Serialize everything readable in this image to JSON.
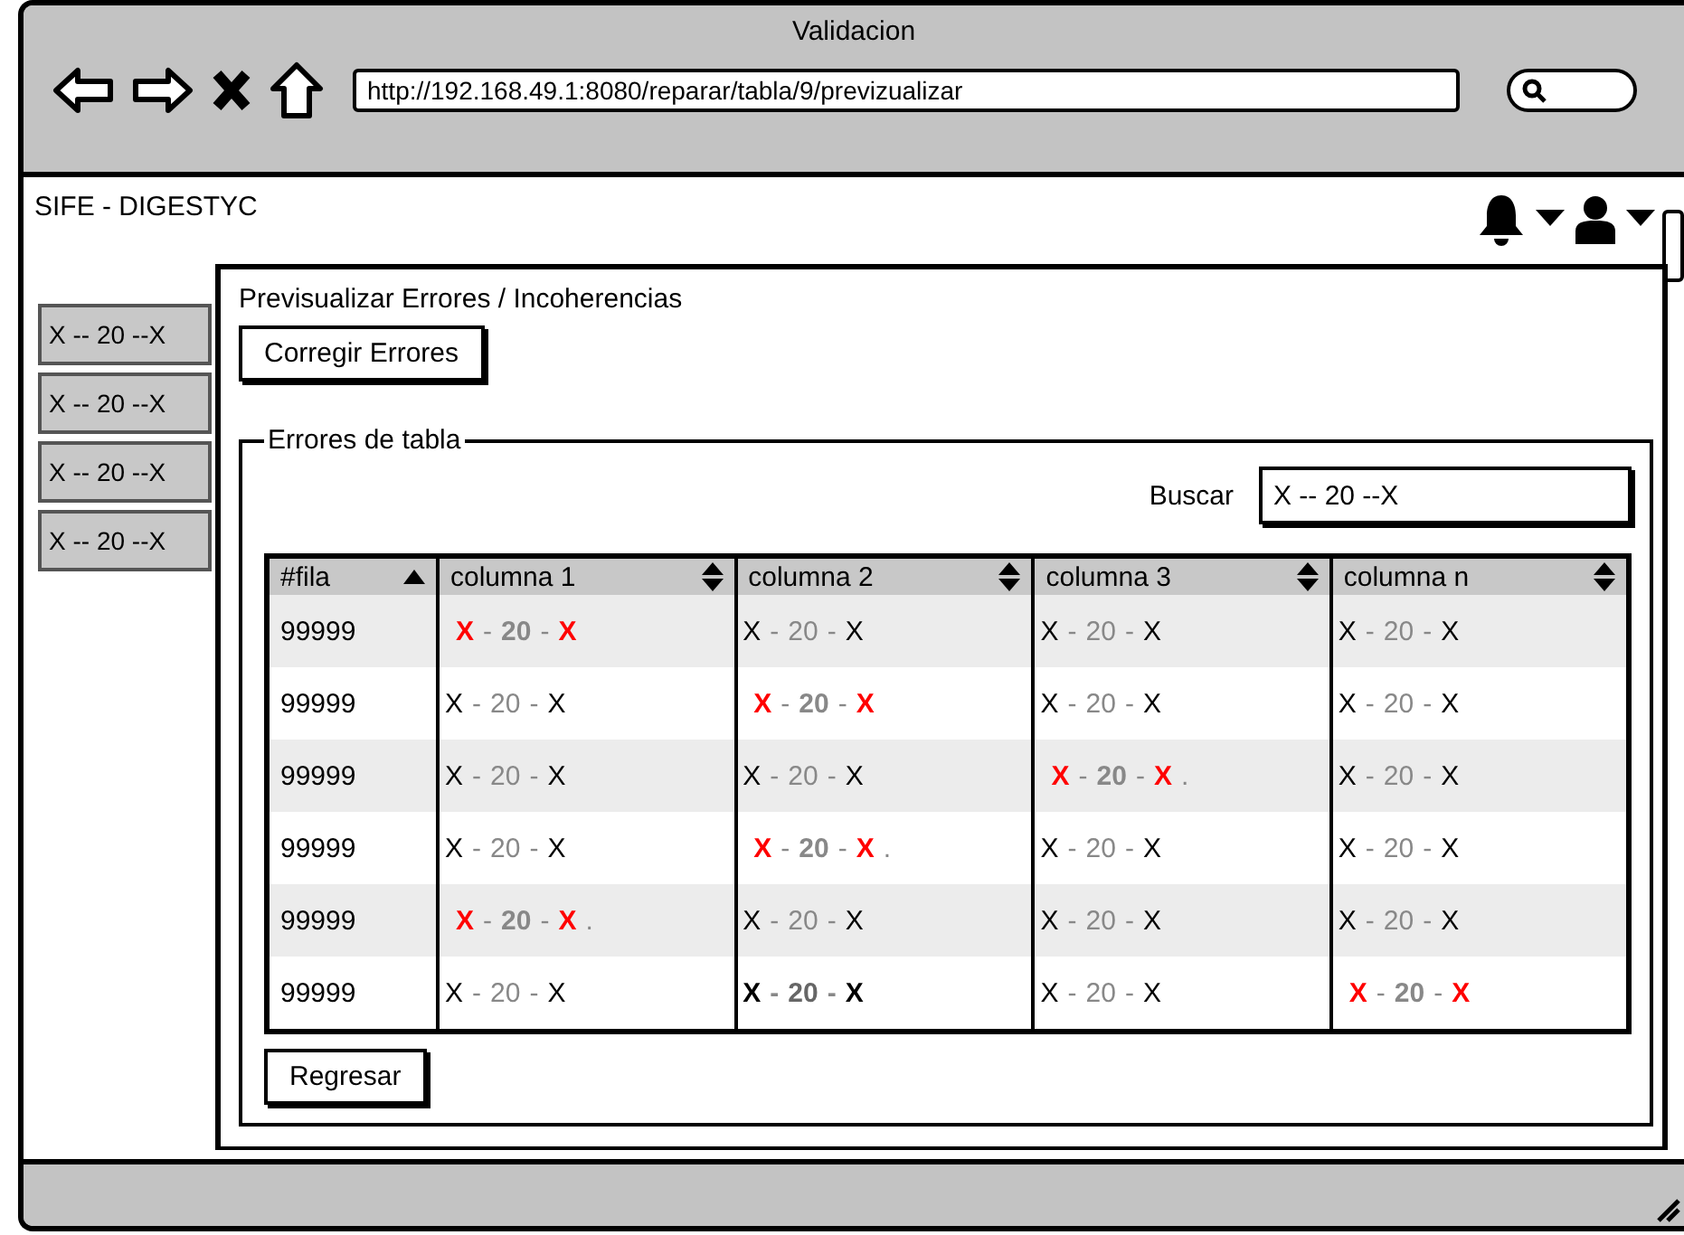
{
  "window": {
    "title": "Validacion",
    "url": "http://192.168.49.1:8080/reparar/tabla/9/previzualizar"
  },
  "app": {
    "brand": "SIFE - DIGESTYC"
  },
  "sidebar": {
    "items": [
      "X -- 20 --X",
      "X -- 20 --X",
      "X -- 20 --X",
      "X -- 20 --X"
    ]
  },
  "panel": {
    "breadcrumb": "Previsualizar Errores / Incoherencias",
    "fix_button": "Corregir Errores",
    "group_title": "Errores de tabla",
    "search": {
      "label": "Buscar",
      "value": "X -- 20 --X"
    },
    "table": {
      "columns": [
        {
          "label": "#fila",
          "sorted": true
        },
        {
          "label": "columna 1",
          "sorted": false
        },
        {
          "label": "columna 2",
          "sorted": false
        },
        {
          "label": "columna 3",
          "sorted": false
        },
        {
          "label": "columna n",
          "sorted": false
        }
      ],
      "rows": [
        {
          "cells": [
            {
              "kind": "id",
              "parts": [
                "99999"
              ]
            },
            {
              "kind": "error",
              "parts": [
                "X",
                "-",
                "20",
                "-",
                "X"
              ]
            },
            {
              "kind": "normal",
              "parts": [
                "X",
                "-",
                "20",
                "-",
                "X"
              ]
            },
            {
              "kind": "normal",
              "parts": [
                "X",
                "-",
                "20",
                "-",
                "X"
              ]
            },
            {
              "kind": "normal",
              "parts": [
                "X",
                "-",
                "20",
                "-",
                "X"
              ]
            }
          ]
        },
        {
          "cells": [
            {
              "kind": "id",
              "parts": [
                "99999"
              ]
            },
            {
              "kind": "normal",
              "parts": [
                "X",
                "-",
                "20",
                "-",
                "X"
              ]
            },
            {
              "kind": "error",
              "parts": [
                "X",
                "-",
                "20",
                "-",
                "X"
              ]
            },
            {
              "kind": "normal",
              "parts": [
                "X",
                "-",
                "20",
                "-",
                "X"
              ]
            },
            {
              "kind": "normal",
              "parts": [
                "X",
                "-",
                "20",
                "-",
                "X"
              ]
            }
          ]
        },
        {
          "cells": [
            {
              "kind": "id",
              "parts": [
                "99999"
              ]
            },
            {
              "kind": "normal",
              "parts": [
                "X",
                "-",
                "20",
                "-",
                "X"
              ]
            },
            {
              "kind": "normal",
              "parts": [
                "X",
                "-",
                "20",
                "-",
                "X"
              ]
            },
            {
              "kind": "error",
              "parts": [
                "X",
                "-",
                "20",
                "-",
                "X",
                "."
              ]
            },
            {
              "kind": "normal",
              "parts": [
                "X",
                "-",
                "20",
                "-",
                "X"
              ]
            }
          ]
        },
        {
          "cells": [
            {
              "kind": "id",
              "parts": [
                "99999"
              ]
            },
            {
              "kind": "normal",
              "parts": [
                "X",
                "-",
                "20",
                "-",
                "X"
              ]
            },
            {
              "kind": "error",
              "parts": [
                "X",
                "-",
                "20",
                "-",
                "X",
                "."
              ]
            },
            {
              "kind": "normal",
              "parts": [
                "X",
                "-",
                "20",
                "-",
                "X"
              ]
            },
            {
              "kind": "normal",
              "parts": [
                "X",
                "-",
                "20",
                "-",
                "X"
              ]
            }
          ]
        },
        {
          "cells": [
            {
              "kind": "id",
              "parts": [
                "99999"
              ]
            },
            {
              "kind": "error",
              "parts": [
                "X",
                "-",
                "20",
                "-",
                "X",
                "."
              ]
            },
            {
              "kind": "normal",
              "parts": [
                "X",
                "-",
                "20",
                "-",
                "X"
              ]
            },
            {
              "kind": "normal",
              "parts": [
                "X",
                "-",
                "20",
                "-",
                "X"
              ]
            },
            {
              "kind": "normal",
              "parts": [
                "X",
                "-",
                "20",
                "-",
                "X"
              ]
            }
          ]
        },
        {
          "cells": [
            {
              "kind": "id",
              "parts": [
                "99999"
              ]
            },
            {
              "kind": "normal",
              "parts": [
                "X",
                "-",
                "20",
                "-",
                "X"
              ]
            },
            {
              "kind": "bold",
              "parts": [
                "X",
                "-",
                "20",
                "-",
                "X"
              ]
            },
            {
              "kind": "normal",
              "parts": [
                "X",
                "-",
                "20",
                "-",
                "X"
              ]
            },
            {
              "kind": "error",
              "parts": [
                "X",
                "-",
                "20",
                "-",
                "X"
              ]
            }
          ]
        }
      ]
    },
    "back_button": "Regresar"
  }
}
